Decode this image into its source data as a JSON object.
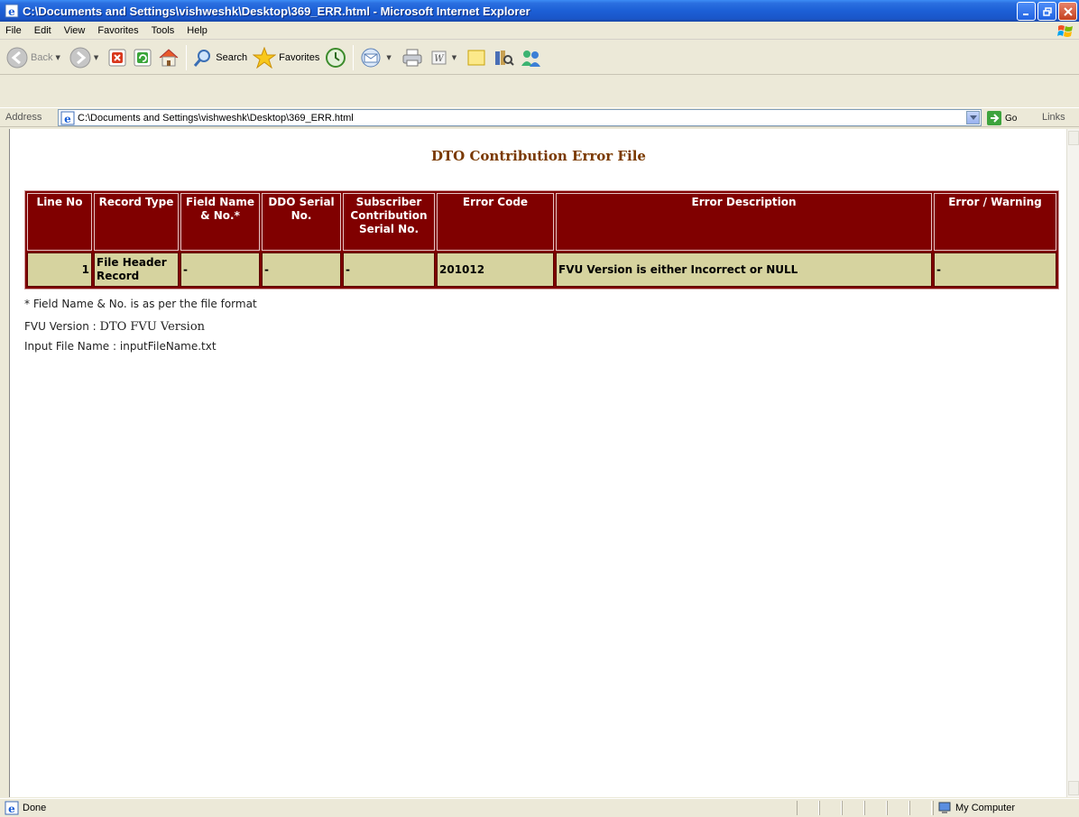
{
  "window": {
    "title": "C:\\Documents and Settings\\vishweshk\\Desktop\\369_ERR.html - Microsoft Internet Explorer"
  },
  "menu": [
    "File",
    "Edit",
    "View",
    "Favorites",
    "Tools",
    "Help"
  ],
  "toolbar": {
    "back_label": "Back",
    "search_label": "Search",
    "favorites_label": "Favorites"
  },
  "address": {
    "label": "Address",
    "value": "C:\\Documents and Settings\\vishweshk\\Desktop\\369_ERR.html",
    "go_label": "Go",
    "links_label": "Links"
  },
  "page": {
    "title": "DTO Contribution Error File",
    "table": {
      "headers": [
        "Line No",
        "Record Type",
        "Field Name & No.*",
        "DDO Serial No.",
        "Subscriber Contribution Serial No.",
        "Error Code",
        "Error Description",
        "Error / Warning"
      ],
      "rows": [
        [
          "1",
          "File Header Record",
          "-",
          "-",
          "-",
          "201012",
          "FVU Version is either Incorrect or NULL",
          "-"
        ]
      ]
    },
    "footnote": "* Field Name & No. is as per the file format",
    "fvu_label": "FVU Version :",
    "fvu_value": "DTO FVU Version",
    "input_label": "Input File Name :",
    "input_value": "inputFileName.txt"
  },
  "status": {
    "text": "Done",
    "zone": "My Computer"
  },
  "colors": {
    "header_bg": "#800000",
    "row_bg": "#d6d39f",
    "title_color": "#7a3900"
  }
}
